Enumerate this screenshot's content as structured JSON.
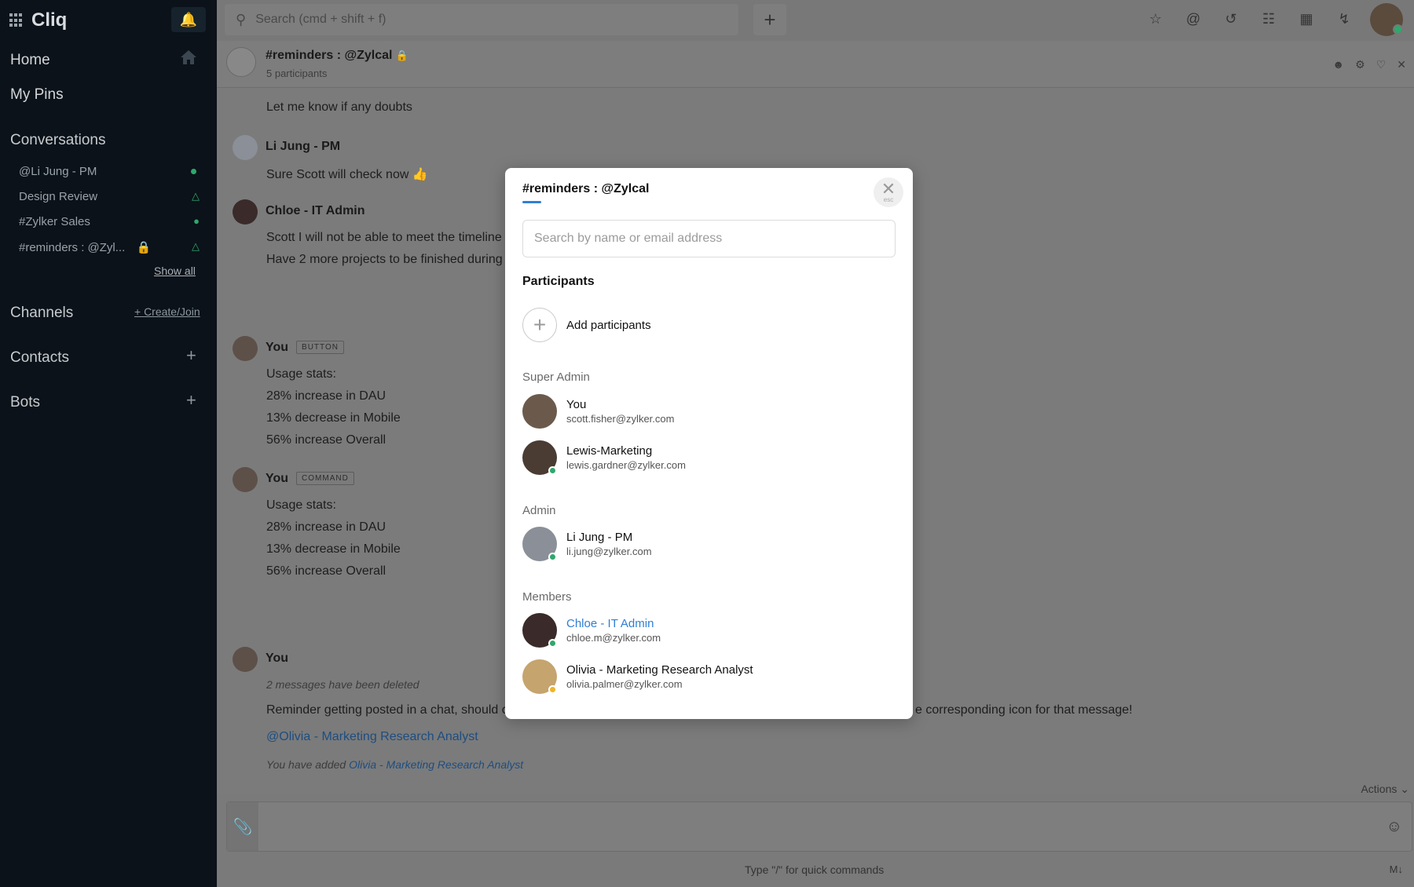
{
  "app": {
    "name": "Cliq"
  },
  "sidebar": {
    "home": "Home",
    "my_pins": "My Pins",
    "conversations_title": "Conversations",
    "conversations": [
      {
        "label": "@Li Jung - PM"
      },
      {
        "label": "Design Review"
      },
      {
        "label": "#Zylker Sales"
      },
      {
        "label": "#reminders : @Zyl..."
      }
    ],
    "show_all": "Show all",
    "channels_title": "Channels",
    "create_join": "+ Create/Join",
    "contacts_title": "Contacts",
    "bots_title": "Bots"
  },
  "header": {
    "search_placeholder": "Search (cmd + shift + f)",
    "icons": [
      "star-icon",
      "mention-icon",
      "history-icon",
      "clipboard-icon",
      "calendar-icon",
      "plug-icon"
    ]
  },
  "chat": {
    "title": "#reminders : @Zylcal",
    "participants_count": "5 participants",
    "messages": {
      "m0": "Let me know if any doubts",
      "li_sender": "Li Jung - PM",
      "li_text": "Sure Scott will check now 👍",
      "chloe_sender": "Chloe - IT Admin",
      "chloe_line1": "Scott I will not be able to meet the timeline",
      "chloe_line2": "Have 2 more projects to be finished during",
      "you1_sender": "You",
      "you1_badge": "BUTTON",
      "you2_sender": "You",
      "you2_badge": "COMMAND",
      "stats_title": "Usage stats:",
      "stats_1": "28% increase in DAU",
      "stats_2": "13% decrease in Mobile",
      "stats_3": "56% increase Overall",
      "you3_sender": "You",
      "deleted": "2 messages have been deleted",
      "reminder_left": "Reminder getting posted in a chat, should co",
      "reminder_right": "e corresponding icon for that message!",
      "mention": "@Olivia - Marketing Research Analyst",
      "added_prefix": "You have added",
      "added_name": "Olivia - Marketing Research Analyst"
    },
    "actions": "Actions",
    "composer_hint": "Type \"/\" for quick commands",
    "md": "M↓"
  },
  "modal": {
    "title": "#reminders : @Zylcal",
    "close_esc": "esc",
    "search_placeholder": "Search by name or email address",
    "participants_heading": "Participants",
    "add_participants": "Add participants",
    "super_admin_heading": "Super Admin",
    "admin_heading": "Admin",
    "members_heading": "Members",
    "super_admins": [
      {
        "name": "You",
        "email": "scott.fisher@zylker.com",
        "color": "#6b5a4c"
      },
      {
        "name": "Lewis-Marketing",
        "email": "lewis.gardner@zylker.com",
        "color": "#4a3b33"
      }
    ],
    "admins": [
      {
        "name": "Li Jung - PM",
        "email": "li.jung@zylker.com",
        "color": "#8a8f98"
      }
    ],
    "members": [
      {
        "name": "Chloe - IT Admin",
        "email": "chloe.m@zylker.com",
        "color": "#3b2a2a"
      },
      {
        "name": "Olivia - Marketing Research Analyst",
        "email": "olivia.palmer@zylker.com",
        "color": "#c5a46e"
      }
    ]
  },
  "colors": {
    "accent": "#2f7fd4",
    "online": "#2fa86c",
    "away": "#f0b429",
    "sidebar_bg": "#0b1219"
  }
}
